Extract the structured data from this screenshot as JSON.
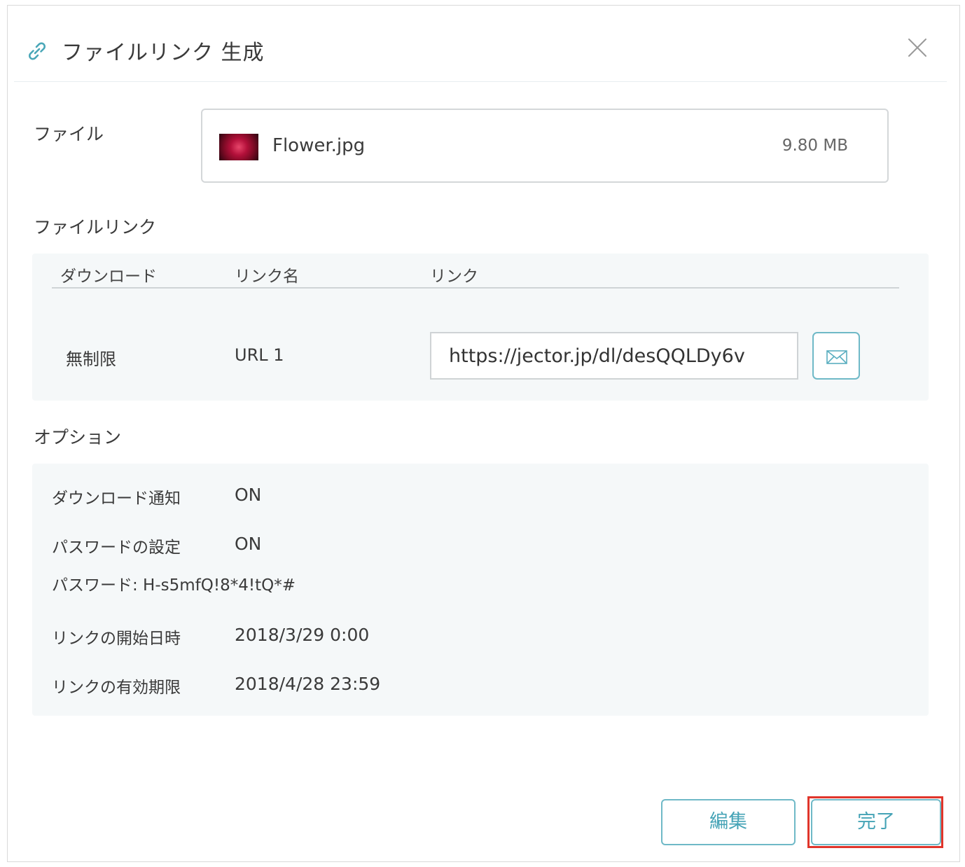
{
  "dialog": {
    "title": "ファイルリンク 生成",
    "title_icon": "link-icon",
    "close_icon": "close-icon"
  },
  "file_section": {
    "label": "ファイル",
    "file_name": "Flower.jpg",
    "file_size": "9.80 MB",
    "thumbnail": "flower-thumbnail"
  },
  "link_section": {
    "label": "ファイルリンク",
    "columns": [
      "ダウンロード",
      "リンク名",
      "リンク"
    ],
    "rows": [
      {
        "download": "無制限",
        "link_name": "URL 1",
        "url": "https://jector.jp/dl/desQQLDy6v",
        "mail_icon": "mail-icon"
      }
    ]
  },
  "options_section": {
    "label": "オプション",
    "download_notify_label": "ダウンロード通知",
    "download_notify_value": "ON",
    "password_label": "パスワードの設定",
    "password_value": "ON",
    "password_line": "パスワード: H-s5mfQ!8*4!tQ*#",
    "start_label": "リンクの開始日時",
    "start_value": "2018/3/29 0:00",
    "expiry_label": "リンクの有効期限",
    "expiry_value": "2018/4/28 23:59"
  },
  "footer": {
    "edit_label": "編集",
    "done_label": "完了"
  },
  "colors": {
    "accent": "#45a3b6",
    "accent_border": "#6fb9c7",
    "highlight": "#e0352b",
    "panel_bg": "#f5f8f9"
  }
}
